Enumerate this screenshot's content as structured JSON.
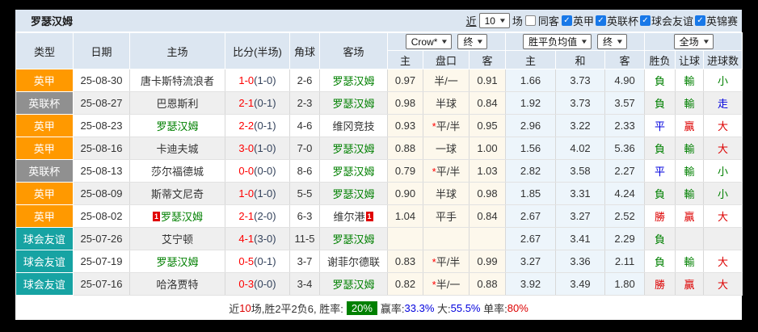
{
  "window": {
    "title": "罗瑟汉姆"
  },
  "toolbar": {
    "near_label": "近",
    "matches_select": "10",
    "matches_label": "场",
    "same_venue_label": "同客",
    "same_venue_checked": false,
    "league_filters": [
      {
        "label": "英甲",
        "checked": true
      },
      {
        "label": "英联杯",
        "checked": true
      },
      {
        "label": "球会友谊",
        "checked": true
      },
      {
        "label": "英锦赛",
        "checked": true
      }
    ]
  },
  "header": {
    "columns": [
      "类型",
      "日期",
      "主场",
      "比分(半场)",
      "角球",
      "客场"
    ],
    "selects": {
      "bookmaker": "Crow*",
      "handicap_time": "终",
      "europe": "胜平负均值",
      "europe_time": "终",
      "scope": "全场"
    },
    "sub_columns": [
      "主",
      "盘口",
      "客",
      "主",
      "和",
      "客",
      "胜负",
      "让球",
      "进球数"
    ]
  },
  "colors": {
    "g": "#008000",
    "r": "#dd0000",
    "b": "#0000dd",
    "league_one": "#ff9900",
    "league_cup": "#909090",
    "friendly": "#17a3a3",
    "header_bg": "#dce6f1",
    "handicap_bg": "#fdf8ec",
    "europe_bg": "#edf5fb",
    "score_red": "#fe0000",
    "badge_green": "#008000"
  },
  "table": {
    "rows": [
      {
        "league": "英甲",
        "league_color": "#ff9900",
        "date": "25-08-30",
        "home": "唐卡斯特流浪者",
        "home_green": false,
        "home_card": false,
        "score_ft": "1-0",
        "score_ht": "(1-0)",
        "corners": "2-6",
        "away": "罗瑟汉姆",
        "away_green": true,
        "away_card": false,
        "ah_home": "0.97",
        "ah_star": false,
        "ah_line": "半/一",
        "ah_away": "0.91",
        "eu_win": "1.66",
        "eu_draw": "3.73",
        "eu_lose": "4.90",
        "res_wdl": "負",
        "res_wdl_c": "g",
        "res_ah": "輸",
        "res_ah_c": "g",
        "res_ou": "小",
        "res_ou_c": "g"
      },
      {
        "league": "英联杯",
        "league_color": "#909090",
        "date": "25-08-27",
        "home": "巴恩斯利",
        "home_green": false,
        "home_card": false,
        "score_ft": "2-1",
        "score_ht": "(0-1)",
        "corners": "2-3",
        "away": "罗瑟汉姆",
        "away_green": true,
        "away_card": false,
        "ah_home": "0.98",
        "ah_star": false,
        "ah_line": "半球",
        "ah_away": "0.84",
        "eu_win": "1.92",
        "eu_draw": "3.73",
        "eu_lose": "3.57",
        "res_wdl": "負",
        "res_wdl_c": "g",
        "res_ah": "輸",
        "res_ah_c": "g",
        "res_ou": "走",
        "res_ou_c": "b"
      },
      {
        "league": "英甲",
        "league_color": "#ff9900",
        "date": "25-08-23",
        "home": "罗瑟汉姆",
        "home_green": true,
        "home_card": false,
        "score_ft": "2-2",
        "score_ht": "(0-1)",
        "corners": "4-6",
        "away": "维冈竞技",
        "away_green": false,
        "away_card": false,
        "ah_home": "0.93",
        "ah_star": true,
        "ah_line": "平/半",
        "ah_away": "0.95",
        "eu_win": "2.96",
        "eu_draw": "3.22",
        "eu_lose": "2.33",
        "res_wdl": "平",
        "res_wdl_c": "b",
        "res_ah": "贏",
        "res_ah_c": "r",
        "res_ou": "大",
        "res_ou_c": "r"
      },
      {
        "league": "英甲",
        "league_color": "#ff9900",
        "date": "25-08-16",
        "home": "卡迪夫城",
        "home_green": false,
        "home_card": false,
        "score_ft": "3-0",
        "score_ht": "(1-0)",
        "corners": "7-0",
        "away": "罗瑟汉姆",
        "away_green": true,
        "away_card": false,
        "ah_home": "0.88",
        "ah_star": false,
        "ah_line": "一球",
        "ah_away": "1.00",
        "eu_win": "1.56",
        "eu_draw": "4.02",
        "eu_lose": "5.36",
        "res_wdl": "負",
        "res_wdl_c": "g",
        "res_ah": "輸",
        "res_ah_c": "g",
        "res_ou": "大",
        "res_ou_c": "r"
      },
      {
        "league": "英联杯",
        "league_color": "#909090",
        "date": "25-08-13",
        "home": "莎尔福德城",
        "home_green": false,
        "home_card": false,
        "score_ft": "0-0",
        "score_ht": "(0-0)",
        "corners": "8-6",
        "away": "罗瑟汉姆",
        "away_green": true,
        "away_card": false,
        "ah_home": "0.79",
        "ah_star": true,
        "ah_line": "平/半",
        "ah_away": "1.03",
        "eu_win": "2.82",
        "eu_draw": "3.58",
        "eu_lose": "2.27",
        "res_wdl": "平",
        "res_wdl_c": "b",
        "res_ah": "輸",
        "res_ah_c": "g",
        "res_ou": "小",
        "res_ou_c": "g"
      },
      {
        "league": "英甲",
        "league_color": "#ff9900",
        "date": "25-08-09",
        "home": "斯蒂文尼奇",
        "home_green": false,
        "home_card": false,
        "score_ft": "1-0",
        "score_ht": "(1-0)",
        "corners": "5-5",
        "away": "罗瑟汉姆",
        "away_green": true,
        "away_card": false,
        "ah_home": "0.90",
        "ah_star": false,
        "ah_line": "半球",
        "ah_away": "0.98",
        "eu_win": "1.85",
        "eu_draw": "3.31",
        "eu_lose": "4.24",
        "res_wdl": "負",
        "res_wdl_c": "g",
        "res_ah": "輸",
        "res_ah_c": "g",
        "res_ou": "小",
        "res_ou_c": "g"
      },
      {
        "league": "英甲",
        "league_color": "#ff9900",
        "date": "25-08-02",
        "home": "罗瑟汉姆",
        "home_green": true,
        "home_card": true,
        "score_ft": "2-1",
        "score_ht": "(2-0)",
        "corners": "6-3",
        "away": "维尔港",
        "away_green": false,
        "away_card": true,
        "ah_home": "1.04",
        "ah_star": false,
        "ah_line": "平手",
        "ah_away": "0.84",
        "eu_win": "2.67",
        "eu_draw": "3.27",
        "eu_lose": "2.52",
        "res_wdl": "勝",
        "res_wdl_c": "r",
        "res_ah": "贏",
        "res_ah_c": "r",
        "res_ou": "大",
        "res_ou_c": "r"
      },
      {
        "league": "球会友谊",
        "league_color": "#17a3a3",
        "date": "25-07-26",
        "home": "艾宁顿",
        "home_green": false,
        "home_card": false,
        "score_ft": "4-1",
        "score_ht": "(3-0)",
        "corners": "11-5",
        "away": "罗瑟汉姆",
        "away_green": true,
        "away_card": false,
        "ah_home": "",
        "ah_star": false,
        "ah_line": "",
        "ah_away": "",
        "eu_win": "2.67",
        "eu_draw": "3.41",
        "eu_lose": "2.29",
        "res_wdl": "負",
        "res_wdl_c": "g",
        "res_ah": "",
        "res_ah_c": "",
        "res_ou": "",
        "res_ou_c": ""
      },
      {
        "league": "球会友谊",
        "league_color": "#17a3a3",
        "date": "25-07-19",
        "home": "罗瑟汉姆",
        "home_green": true,
        "home_card": false,
        "score_ft": "0-5",
        "score_ht": "(0-1)",
        "corners": "3-7",
        "away": "谢菲尔德联",
        "away_green": false,
        "away_card": false,
        "ah_home": "0.83",
        "ah_star": true,
        "ah_line": "平/半",
        "ah_away": "0.99",
        "eu_win": "3.27",
        "eu_draw": "3.36",
        "eu_lose": "2.11",
        "res_wdl": "負",
        "res_wdl_c": "g",
        "res_ah": "輸",
        "res_ah_c": "g",
        "res_ou": "大",
        "res_ou_c": "r"
      },
      {
        "league": "球会友谊",
        "league_color": "#17a3a3",
        "date": "25-07-16",
        "home": "哈洛贾特",
        "home_green": false,
        "home_card": false,
        "score_ft": "0-3",
        "score_ht": "(0-0)",
        "corners": "3-4",
        "away": "罗瑟汉姆",
        "away_green": true,
        "away_card": false,
        "ah_home": "0.82",
        "ah_star": true,
        "ah_line": "半/一",
        "ah_away": "0.88",
        "eu_win": "3.92",
        "eu_draw": "3.49",
        "eu_lose": "1.80",
        "res_wdl": "勝",
        "res_wdl_c": "r",
        "res_ah": "贏",
        "res_ah_c": "r",
        "res_ou": "大",
        "res_ou_c": "r"
      }
    ]
  },
  "summary": {
    "parts": [
      {
        "text": "近",
        "color": ""
      },
      {
        "text": "10",
        "color": "r"
      },
      {
        "text": "场,胜2平2负6, 胜率:",
        "color": ""
      },
      {
        "text": "20%",
        "badge": true
      },
      {
        "text": "赢率:",
        "color": ""
      },
      {
        "text": "33.3%",
        "color": "b"
      },
      {
        "text": " 大:",
        "color": ""
      },
      {
        "text": "55.5%",
        "color": "b"
      },
      {
        "text": " 单率:",
        "color": ""
      },
      {
        "text": "80%",
        "color": "r"
      }
    ]
  }
}
